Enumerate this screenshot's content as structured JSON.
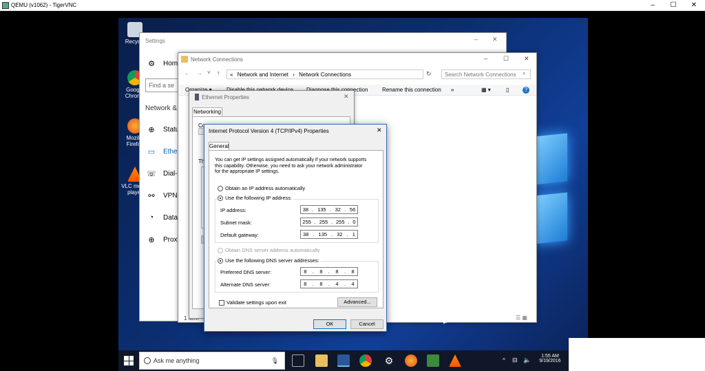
{
  "host": {
    "title": "QEMU (v1062) - TigerVNC",
    "controls": {
      "minimize": "–",
      "maximize": "☐",
      "close": "✕"
    }
  },
  "desktop": {
    "icons": [
      {
        "label": "Recycle"
      },
      {
        "label": "Google Chrome"
      },
      {
        "label": "Mozilla Firefox"
      },
      {
        "label": "VLC media player"
      }
    ]
  },
  "settings": {
    "title": "Settings",
    "home": "Home",
    "search_placeholder": "Find a se",
    "section": "Network &",
    "items": [
      {
        "label": "Status",
        "icon": "globe-icon"
      },
      {
        "label": "Ethernet",
        "icon": "monitor-icon"
      },
      {
        "label": "Dial-up",
        "icon": "phone-icon"
      },
      {
        "label": "VPN",
        "icon": "vpn-icon"
      },
      {
        "label": "Data usage",
        "icon": "clock-icon"
      },
      {
        "label": "Proxy",
        "icon": "globe-icon"
      }
    ],
    "displayed_items": [
      "Statu",
      "Ether",
      "Dial-u",
      "VPN",
      "Data",
      "Proxy"
    ]
  },
  "network_connections": {
    "title": "Network Connections",
    "breadcrumb": [
      "«",
      "Network and Internet",
      "›",
      "Network Connections"
    ],
    "search_placeholder": "Search Network Connections",
    "toolbar": [
      "Organize ▾",
      "Disable this network device",
      "Diagnose this connection",
      "Rename this connection",
      "»"
    ],
    "status": "1 item"
  },
  "ethernet_properties": {
    "title": "Ethernet Properties",
    "tab": "Networking",
    "connect_using": "Connec",
    "this_uses": "Th"
  },
  "ipv4": {
    "title": "Internet Protocol Version 4 (TCP/IPv4) Properties",
    "tab": "General",
    "intro": "You can get IP settings assigned automatically if your network supports this capability. Otherwise, you need to ask your network administrator for the appropriate IP settings.",
    "intro_lines": [
      "You can get IP settings assigned automatically if your network supports",
      "this capability. Otherwise, you need to ask your network administrator",
      "for the appropriate IP settings."
    ],
    "obtain_ip_auto": "Obtain an IP address automatically",
    "use_following_ip": "Use the following IP address:",
    "ip_label": "IP address:",
    "ip": [
      "38",
      "135",
      "32",
      "56"
    ],
    "subnet_label": "Subnet mask:",
    "subnet": [
      "255",
      "255",
      "255",
      "0"
    ],
    "gateway_label": "Default gateway:",
    "gateway": [
      "38",
      "135",
      "32",
      "1"
    ],
    "obtain_dns_auto": "Obtain DNS server address automatically",
    "use_following_dns": "Use the following DNS server addresses:",
    "pref_dns_label": "Preferred DNS server:",
    "pref_dns": [
      "8",
      "8",
      "8",
      "8"
    ],
    "alt_dns_label": "Alternate DNS server:",
    "alt_dns": [
      "8",
      "8",
      "4",
      "4"
    ],
    "validate": "Validate settings upon exit",
    "advanced": "Advanced...",
    "ok": "OK",
    "cancel": "Cancel"
  },
  "taskbar": {
    "search": "Ask me anything",
    "time": "1:55 AM",
    "date": "9/19/2016"
  }
}
